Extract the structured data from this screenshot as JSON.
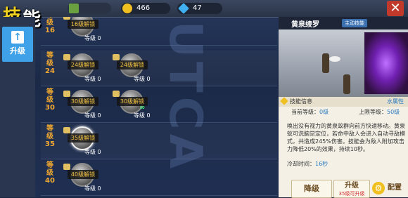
{
  "header": {
    "title": "技能",
    "resources": [
      {
        "icon": "gold-coin-icon",
        "value": "466"
      },
      {
        "icon": "diamond-icon",
        "value": "47"
      }
    ]
  },
  "sidebar": {
    "tab_label": "升级"
  },
  "rows": [
    {
      "level": [
        "等",
        "级",
        "16"
      ],
      "skills": [
        {
          "unlock": "16级解锁",
          "lvl": "等级 0",
          "selected": false
        }
      ]
    },
    {
      "level": [
        "等",
        "级",
        "24"
      ],
      "skills": [
        {
          "unlock": "24级解锁",
          "lvl": "等级 0"
        },
        {
          "unlock": "24级解锁",
          "lvl": "等级 0"
        }
      ]
    },
    {
      "level": [
        "等",
        "级",
        "30"
      ],
      "skills": [
        {
          "unlock": "30级解锁",
          "lvl": "等级 0"
        },
        {
          "unlock": "30级解锁",
          "lvl": "等级 0",
          "badge": "∞"
        }
      ]
    },
    {
      "level": [
        "等",
        "级",
        "35"
      ],
      "skills": [
        {
          "unlock": "35级解锁",
          "lvl": "等级 0",
          "selected": true
        }
      ]
    },
    {
      "level": [
        "等",
        "级",
        "40"
      ],
      "skills": [
        {
          "unlock": "40级解锁",
          "lvl": "等级 0"
        }
      ]
    }
  ],
  "panel": {
    "skill_name": "黄泉绫罗",
    "skill_tag": "主动技能",
    "info_title": "技能信息",
    "element": "水属性",
    "current_label": "当前等级：",
    "current_value": "0级",
    "max_label": "上限等级：",
    "max_value": "50级",
    "description": "唤出没有视力的黄泉蚁群向前方快速移动。黄泉蚁可洗脑觉定位，若命中敌人会进入自动寻敌模式，共造成245%伤害。技能会为敌人附加攻击力降低20%的效果，持续10秒。",
    "cooldown_label": "冷却时间：",
    "cooldown_value": "16秒",
    "btn_down": "降级",
    "btn_up": "升级",
    "btn_up_sub": "35级可升级",
    "btn_config": "配置"
  }
}
